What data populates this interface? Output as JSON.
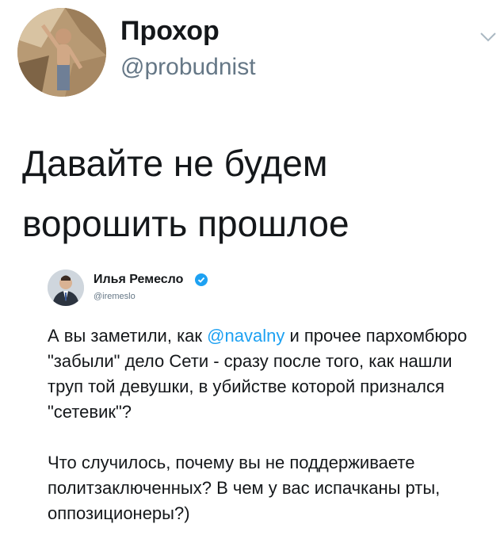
{
  "author": {
    "name": "Прохор",
    "handle": "@probudnist"
  },
  "tweet": {
    "text_line1": "Давайте не будем",
    "text_line2": "ворошить прошлое"
  },
  "quoted": {
    "name": "Илья Ремесло",
    "handle": "@iremeslo",
    "p1_before": "А вы заметили, как ",
    "p1_mention": "@navalny",
    "p1_after": " и прочее пархомбюро \"забыли\" дело Сети - сразу после того, как нашли труп той девушки, в убийстве которой признался \"сетевик\"?",
    "p2": "Что случилось, почему вы не поддерживаете политзаключенных? В чем у вас испачканы рты, оппозиционеры?)"
  },
  "icons": {
    "more": "chevron-down-icon",
    "verified": "verified-badge-icon"
  },
  "colors": {
    "text": "#14171a",
    "secondary": "#657786",
    "link": "#1da1f2"
  }
}
